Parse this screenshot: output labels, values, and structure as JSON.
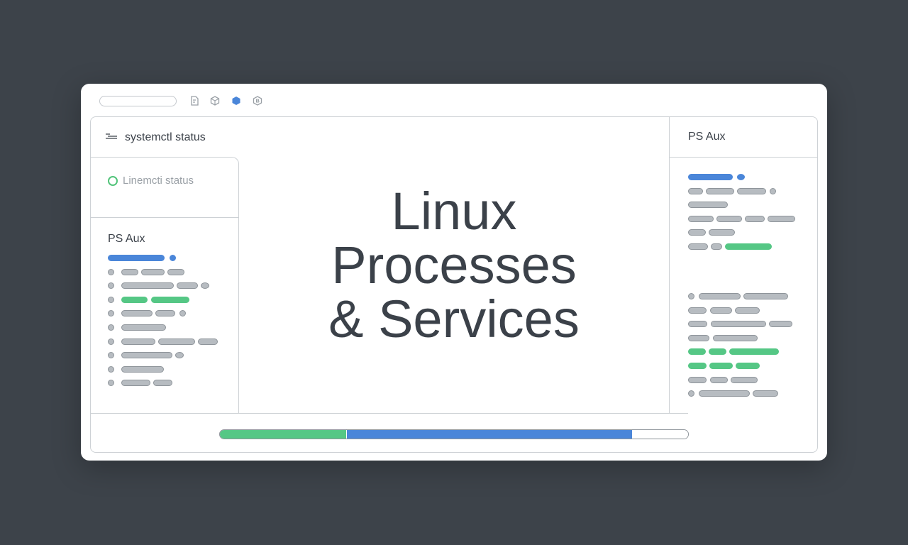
{
  "toolbar": {
    "icons": [
      "document-icon",
      "box-icon",
      "hexagon-icon",
      "shield-icon"
    ],
    "active_icon": "hexagon-icon"
  },
  "left": {
    "header_command": "systemctl status",
    "service_label": "Linemcti status",
    "ps_title": "PS Aux"
  },
  "main": {
    "title_line1": "Linux",
    "title_line2": "Processes",
    "title_line3": "& Services"
  },
  "right": {
    "ps_title": "PS Aux"
  },
  "progress": {
    "segments": [
      {
        "name": "green",
        "fraction": 0.27,
        "color": "#55c785"
      },
      {
        "name": "blue",
        "fraction": 0.61,
        "color": "#4a86d9"
      },
      {
        "name": "empty",
        "fraction": 0.12,
        "color": "#ffffff"
      }
    ]
  },
  "colors": {
    "background": "#3d434a",
    "accent_blue": "#4a86d9",
    "accent_green": "#55c785",
    "text": "#3b4149"
  }
}
